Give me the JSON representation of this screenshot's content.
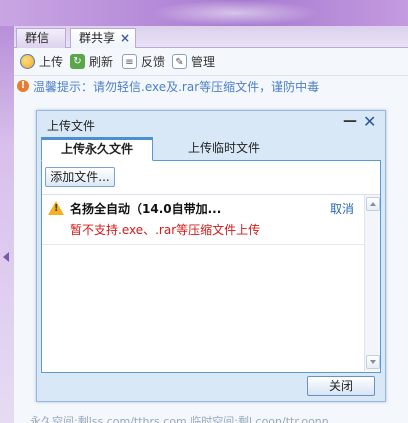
{
  "tabs": [
    {
      "label": "群信息"
    },
    {
      "label": "群共享",
      "close": "×"
    }
  ],
  "toolbar": {
    "upload": "上传",
    "refresh": "刷新",
    "feedback": "反馈",
    "manage": "管理"
  },
  "warning": {
    "icon_text": "!",
    "text": "温馨提示：请勿轻信.exe及.rar等压缩文件，谨防中毒"
  },
  "bottom_text": "永久空间:剩lss.com/tthrs.com 临时空间:剩l.coon/ttr.oonn",
  "dialog": {
    "title": "上传文件",
    "minimize": "—",
    "close": "✕",
    "tabs": [
      {
        "label": "上传永久文件"
      },
      {
        "label": "上传临时文件"
      }
    ],
    "add_button": "添加文件...",
    "items": [
      {
        "name": "名扬全自动（14.0自带加...",
        "cancel": "取消",
        "error": "暂不支持.exe、.rar等压缩文件上传"
      }
    ],
    "close_button": "关闭"
  },
  "colors": {
    "banner": "#b489d8",
    "link": "#2b68b5",
    "error": "#d21a1a",
    "warning_text": "#4d7fc7"
  }
}
